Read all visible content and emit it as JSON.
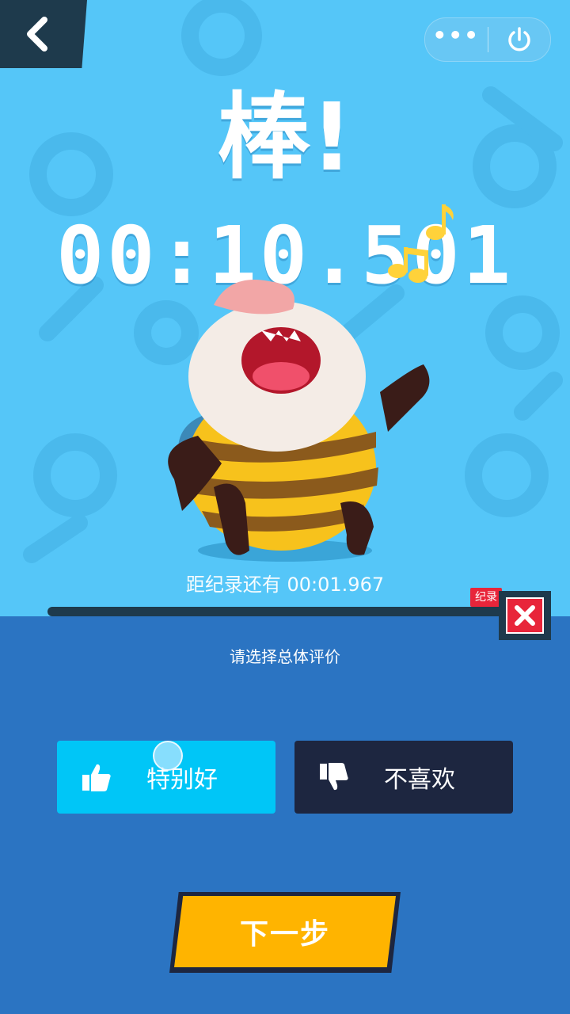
{
  "header": {
    "back_icon": "chevron-left-icon",
    "menu_icon": "more-dots-icon",
    "menu_label": "•••",
    "power_icon": "power-icon"
  },
  "result": {
    "headline": "棒!",
    "time": "00:10.501"
  },
  "record": {
    "gap_text": "距纪录还有 00:01.967",
    "flag_label": "纪录",
    "close_icon": "close-x-icon"
  },
  "rating": {
    "prompt": "请选择总体评价",
    "good_label": "特别好",
    "good_icon": "thumbs-up-icon",
    "bad_label": "不喜欢",
    "bad_icon": "thumbs-down-icon"
  },
  "footer": {
    "next_label": "下一步"
  },
  "colors": {
    "sky": "#55c6f8",
    "panel": "#2b74c2",
    "navy": "#1d2640",
    "cyan_button": "#00c6f7",
    "yellow_button": "#ffb400",
    "red": "#e8253a"
  }
}
